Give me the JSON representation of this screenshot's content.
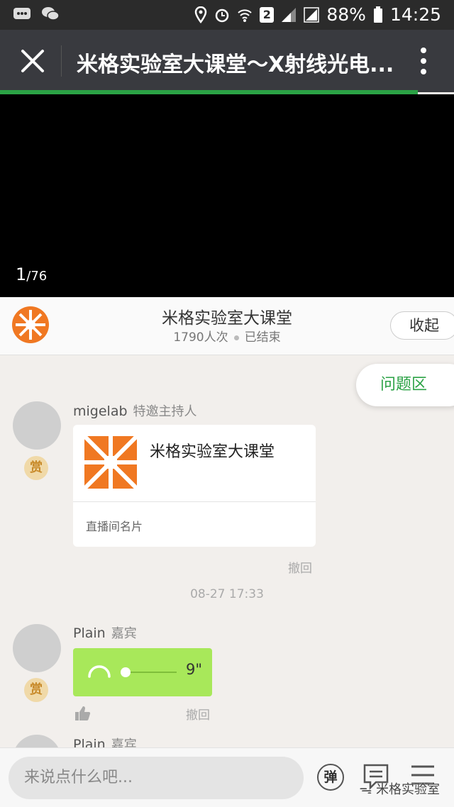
{
  "status_bar": {
    "battery": "88%",
    "time": "14:25",
    "sim_slot": "2"
  },
  "header": {
    "title": "米格实验室大课堂～X射线光电..."
  },
  "player": {
    "page_current": "1",
    "page_total": "/76",
    "load_progress_fraction": 0.92
  },
  "room": {
    "name": "米格实验室大课堂",
    "viewers": "1790人次",
    "status": "已结束",
    "collapse_label": "收起"
  },
  "qa_button": "问题区",
  "messages": [
    {
      "user": "migelab",
      "role": "特邀主持人",
      "reward": "赏",
      "card_title": "米格实验室大课堂",
      "card_footer": "直播间名片",
      "revoke": "撤回"
    },
    {
      "timestamp": "08-27 17:33"
    },
    {
      "user": "Plain",
      "role": "嘉宾",
      "reward": "赏",
      "voice_duration": "9\"",
      "revoke": "撤回"
    },
    {
      "user": "Plain",
      "role": "嘉宾"
    }
  ],
  "composer": {
    "placeholder": "来说点什么吧...",
    "danmu_label": "弹"
  },
  "watermark": "米格实验室",
  "colors": {
    "accent_green": "#2ba245",
    "voice_bubble": "#a8e85a",
    "logo_orange": "#f07822"
  }
}
